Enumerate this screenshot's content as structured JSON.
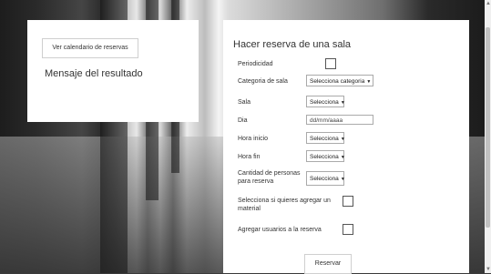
{
  "left_panel": {
    "calendar_button": "Ver calendario de reservas",
    "result_message": "Mensaje del resultado"
  },
  "form": {
    "title": "Hacer reserva de una sala",
    "periodicity_label": "Periodicidad",
    "category_label": "Categoria de sala",
    "category_value": "Selecciona categoria",
    "room_label": "Sala",
    "room_value": "Selecciona",
    "day_label": "Dia",
    "day_placeholder": "dd/mm/aaaa",
    "start_label": "Hora inicio",
    "start_value": "Selecciona",
    "end_label": "Hora fin",
    "end_value": "Selecciona",
    "people_label": "Cantidad de personas para reserva",
    "people_value": "Selecciona",
    "material_label": "Selecciona si quieres agregar un material",
    "users_label": "Agregar usuarios a la reserva",
    "submit_label": "Reservar"
  },
  "icons": {
    "dropdown": "chevron-down-icon"
  }
}
